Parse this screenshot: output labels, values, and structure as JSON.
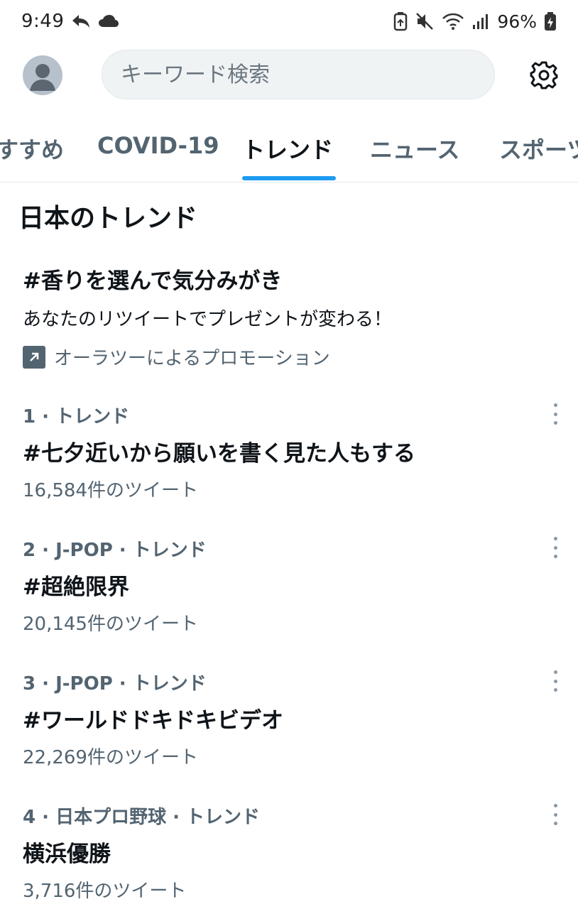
{
  "status_bar": {
    "time": "9:49",
    "battery": "96%",
    "icons": [
      "reply-arrow-icon",
      "cloud-icon",
      "battery-saver-icon",
      "mute-icon",
      "wifi-icon",
      "signal-icon",
      "battery-charging-icon"
    ]
  },
  "header": {
    "search_placeholder": "キーワード検索",
    "avatar_icon": "default-avatar-icon",
    "settings_icon": "gear-icon"
  },
  "tabs": [
    {
      "label": "すすめ"
    },
    {
      "label": "COVID-19"
    },
    {
      "label": "トレンド",
      "active": true
    },
    {
      "label": "ニュース"
    },
    {
      "label": "スポーツ"
    }
  ],
  "section_title": "日本のトレンド",
  "promo": {
    "title": "#香りを選んで気分みがき",
    "description": "あなたのリツイートでプレゼントが変わる！",
    "promoted_by": "オーラツーによるプロモーション",
    "icon": "promoted-arrow-icon"
  },
  "trends": [
    {
      "meta": "1 · トレンド",
      "title": "#七夕近いから願いを書く見た人もする",
      "count": "16,584件のツイート"
    },
    {
      "meta": "2 · J-POP · トレンド",
      "title": "#超絶限界",
      "count": "20,145件のツイート"
    },
    {
      "meta": "3 · J-POP · トレンド",
      "title": "#ワールドドキドキビデオ",
      "count": "22,269件のツイート"
    },
    {
      "meta": "4 · 日本プロ野球 · トレンド",
      "title": "横浜優勝",
      "count": "3,716件のツイート"
    }
  ],
  "colors": {
    "accent": "#1d9bf0",
    "text_primary": "#0f1419",
    "text_secondary": "#536471",
    "search_bg": "#eff3f4"
  }
}
